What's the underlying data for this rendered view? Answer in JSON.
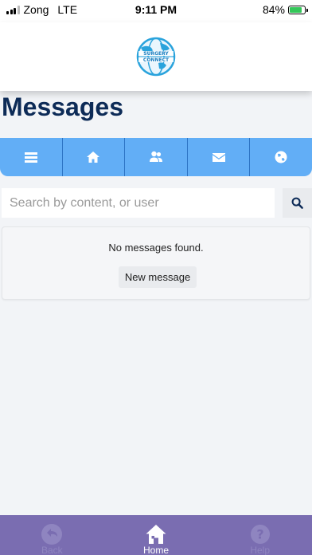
{
  "status_bar": {
    "carrier": "Zong",
    "network": "LTE",
    "time": "9:11 PM",
    "battery": "84%",
    "battery_level": 0.84
  },
  "header": {
    "logo_text_line1": "SURGERY",
    "logo_text_line2": "CONNECT"
  },
  "page": {
    "title": "Messages"
  },
  "navbar": {
    "items": [
      {
        "icon": "menu-icon"
      },
      {
        "icon": "home-icon"
      },
      {
        "icon": "users-icon"
      },
      {
        "icon": "mail-icon"
      },
      {
        "icon": "globe-icon"
      }
    ]
  },
  "search": {
    "placeholder": "Search by content, or user",
    "value": ""
  },
  "messages": {
    "empty_text": "No messages found.",
    "new_message_label": "New message"
  },
  "tabbar": {
    "tabs": [
      {
        "label": "Back",
        "icon": "back-arrow-icon",
        "state": "disabled"
      },
      {
        "label": "Home",
        "icon": "home-icon",
        "state": "active"
      },
      {
        "label": "Help",
        "icon": "help-icon",
        "state": "disabled"
      }
    ]
  },
  "colors": {
    "title": "#0d2b57",
    "navbar": "#62aef6",
    "tabbar": "#7a6db1"
  }
}
